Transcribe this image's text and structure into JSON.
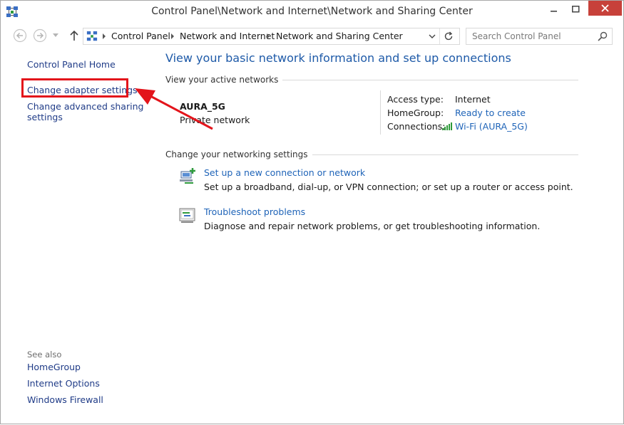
{
  "window": {
    "title": "Control Panel\\Network and Internet\\Network and Sharing Center"
  },
  "address_bar": {
    "crumbs": [
      "Control Panel",
      "Network and Internet",
      "Network and Sharing Center"
    ]
  },
  "search": {
    "placeholder": "Search Control Panel"
  },
  "sidebar": {
    "home": "Control Panel Home",
    "adapter": "Change adapter settings",
    "advanced_line1": "Change advanced sharing",
    "advanced_line2": "settings",
    "see_also": "See also",
    "see_also_items": [
      "HomeGroup",
      "Internet Options",
      "Windows Firewall"
    ]
  },
  "main": {
    "heading": "View your basic network information and set up connections",
    "active_networks_label": "View your active networks",
    "network": {
      "name": "AURA_5G",
      "type": "Private network",
      "access_type_label": "Access type:",
      "access_type_value": "Internet",
      "homegroup_label": "HomeGroup:",
      "homegroup_value": "Ready to create",
      "connections_label": "Connections:",
      "connections_value": "Wi-Fi (AURA_5G)"
    },
    "change_settings_label": "Change your networking settings",
    "tasks": [
      {
        "link": "Set up a new connection or network",
        "desc": "Set up a broadband, dial-up, or VPN connection; or set up a router or access point."
      },
      {
        "link": "Troubleshoot problems",
        "desc": "Diagnose and repair network problems, or get troubleshooting information."
      }
    ]
  },
  "colors": {
    "link": "#1f64b8",
    "heading": "#1e5aa8",
    "close_button": "#c7413a",
    "annotation": "#e3141b"
  },
  "icons": {
    "app": "network-center-icon",
    "back": "back-arrow-icon",
    "forward": "forward-arrow-icon",
    "up": "up-arrow-icon",
    "refresh": "refresh-icon",
    "search": "search-icon",
    "wifi": "wifi-signal-icon"
  }
}
